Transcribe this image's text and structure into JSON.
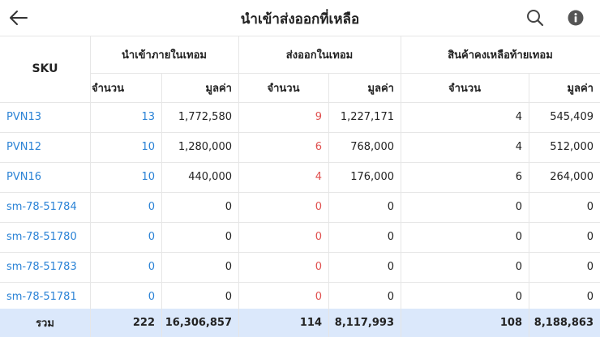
{
  "header": {
    "title": "นำเข้าส่งออกที่เหลือ"
  },
  "table": {
    "sku_label": "SKU",
    "groups": [
      "นำเข้าภายในเทอม",
      "ส่งออกในเทอม",
      "สินค้าคงเหลือท้ายเทอม"
    ],
    "sub_qty": "จำนวน",
    "sub_val": "มูลค่า",
    "rows": [
      {
        "sku": "PVN13",
        "in_qty": "13",
        "in_val": "1,772,580",
        "out_qty": "9",
        "out_val": "1,227,171",
        "end_qty": "4",
        "end_val": "545,409"
      },
      {
        "sku": "PVN12",
        "in_qty": "10",
        "in_val": "1,280,000",
        "out_qty": "6",
        "out_val": "768,000",
        "end_qty": "4",
        "end_val": "512,000"
      },
      {
        "sku": "PVN16",
        "in_qty": "10",
        "in_val": "440,000",
        "out_qty": "4",
        "out_val": "176,000",
        "end_qty": "6",
        "end_val": "264,000"
      },
      {
        "sku": "sm-78-51784",
        "in_qty": "0",
        "in_val": "0",
        "out_qty": "0",
        "out_val": "0",
        "end_qty": "0",
        "end_val": "0"
      },
      {
        "sku": "sm-78-51780",
        "in_qty": "0",
        "in_val": "0",
        "out_qty": "0",
        "out_val": "0",
        "end_qty": "0",
        "end_val": "0"
      },
      {
        "sku": "sm-78-51783",
        "in_qty": "0",
        "in_val": "0",
        "out_qty": "0",
        "out_val": "0",
        "end_qty": "0",
        "end_val": "0"
      },
      {
        "sku": "sm-78-51781",
        "in_qty": "0",
        "in_val": "0",
        "out_qty": "0",
        "out_val": "0",
        "end_qty": "0",
        "end_val": "0"
      }
    ],
    "total": {
      "label": "รวม",
      "in_qty": "222",
      "in_val": "16,306,857",
      "out_qty": "114",
      "out_val": "8,117,993",
      "end_qty": "108",
      "end_val": "8,188,863"
    }
  },
  "colors": {
    "link": "#2b83d6",
    "export": "#e0504f",
    "footer_bg": "#dbe8fb"
  },
  "icons": {
    "back": "arrow-left",
    "search": "magnifier",
    "info": "info-circle"
  }
}
